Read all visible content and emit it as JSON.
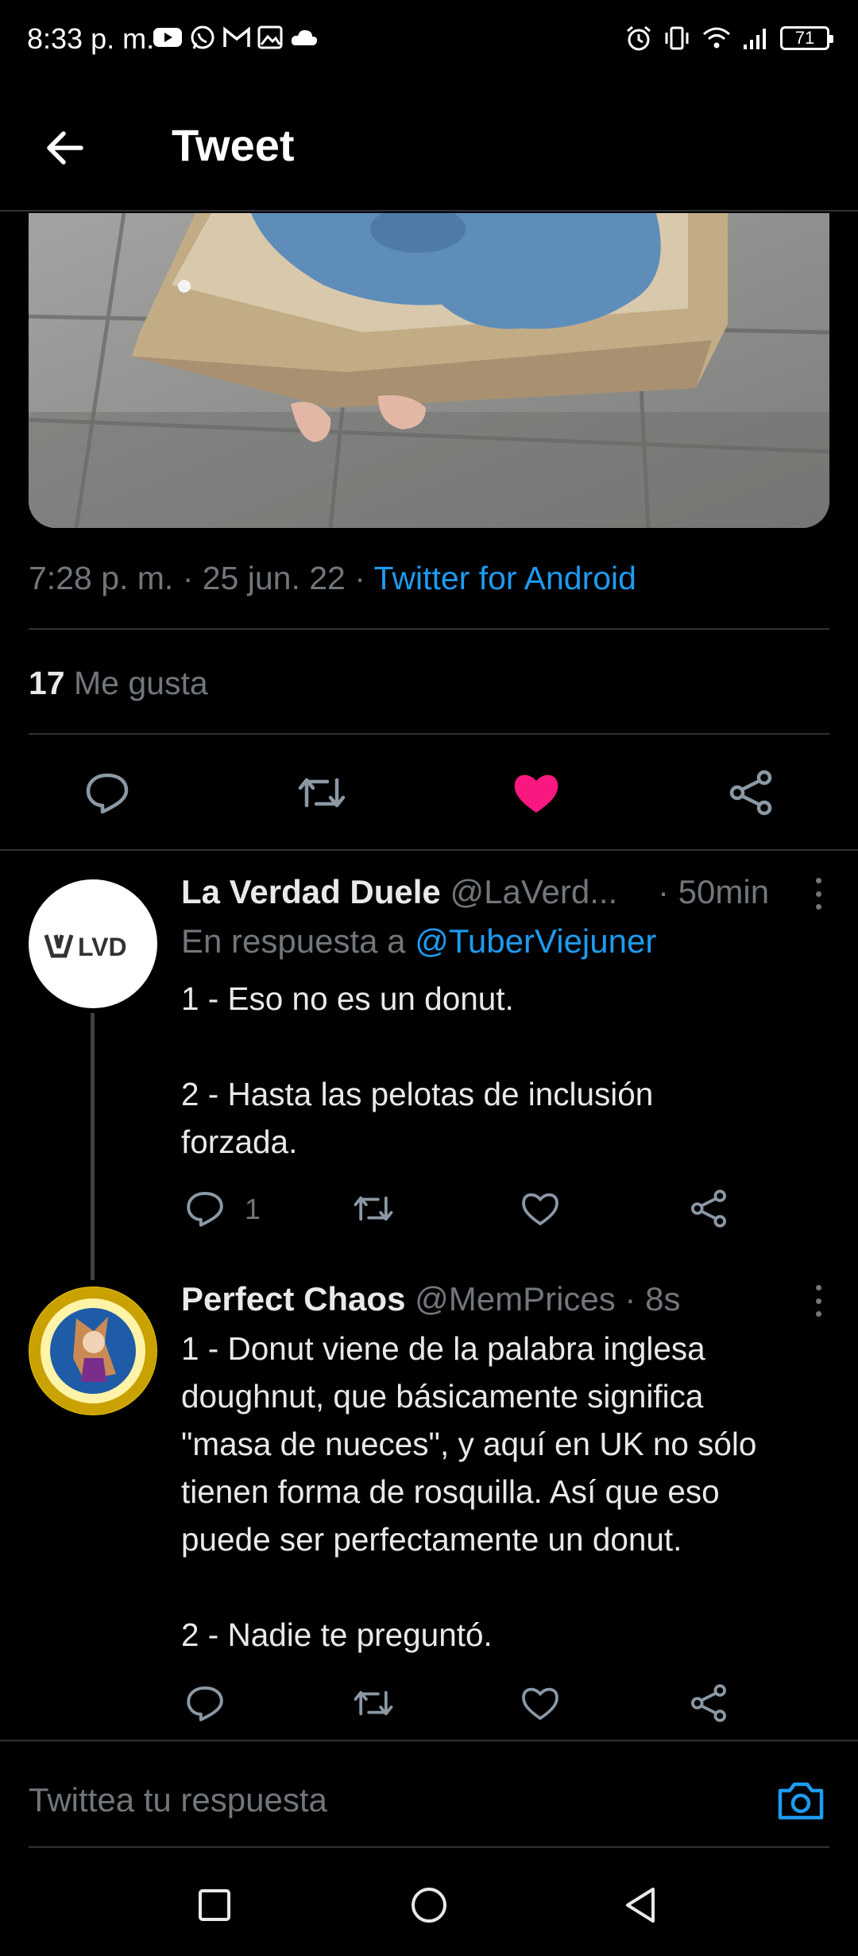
{
  "status_bar": {
    "time": "8:33 p. m.",
    "battery": "71",
    "icons_left": [
      "youtube-icon",
      "whatsapp-icon",
      "gmail-icon",
      "gallery-icon",
      "cloud-icon"
    ],
    "icons_right": [
      "alarm-icon",
      "vibrate-icon",
      "wifi-icon",
      "signal-icon",
      "battery-icon"
    ]
  },
  "header": {
    "title": "Tweet",
    "back_icon": "arrow-left-icon"
  },
  "main_tweet": {
    "timestamp": "7:28 p. m. · 25 jun. 22 · ",
    "source": "Twitter for Android",
    "likes_count": "17",
    "likes_label": " Me gusta",
    "liked": true,
    "accent_color": "#1d9bf0",
    "like_color": "#f91880"
  },
  "replies": [
    {
      "name": "La Verdad Duele",
      "handle": " @LaVerd...",
      "time": "· 50min",
      "replying_prefix": "En respuesta a ",
      "replying_to": "@TuberViejuner",
      "avatar_text": "LVD",
      "text_lines": [
        "1 - Eso no es un donut.",
        "",
        "2 - Hasta las pelotas de inclusión",
        "forzada."
      ],
      "reply_count": "1"
    },
    {
      "name": "Perfect Chaos",
      "handle": " @MemPrices",
      "time": " · 8s",
      "text_lines": [
        "1 - Donut viene de la palabra inglesa",
        "doughnut, que básicamente significa",
        "\"masa de nueces\", y aquí en UK no sólo",
        "tienen forma de rosquilla. Así que eso",
        "puede ser perfectamente un donut.",
        "",
        "2 - Nadie te preguntó."
      ]
    }
  ],
  "compose": {
    "placeholder": "Twittea tu respuesta"
  },
  "nav": {
    "icons": [
      "recents-square-icon",
      "home-circle-icon",
      "back-triangle-icon"
    ]
  }
}
